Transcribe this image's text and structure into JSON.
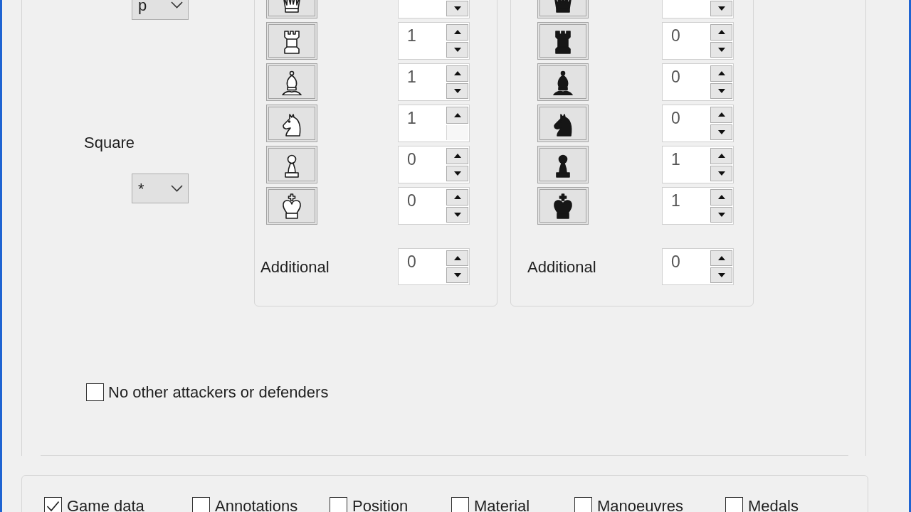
{
  "piece_filter": {
    "value": "p"
  },
  "square": {
    "label": "Square",
    "value": "*"
  },
  "groups": [
    {
      "kind": "white",
      "pieces": [
        {
          "kind": "queen",
          "down_button_shown": true
        },
        {
          "kind": "rook",
          "value": "1",
          "down_button_shown": true
        },
        {
          "kind": "bishop",
          "value": "1",
          "down_button_shown": true
        },
        {
          "kind": "knight",
          "value": "1",
          "down_button_shown": false
        },
        {
          "kind": "pawn",
          "value": "0",
          "down_button_shown": true
        },
        {
          "kind": "king",
          "value": "0",
          "down_button_shown": true
        }
      ],
      "additional": {
        "label": "Additional",
        "value": "0"
      }
    },
    {
      "kind": "black",
      "pieces": [
        {
          "kind": "queen",
          "down_button_shown": true
        },
        {
          "kind": "rook",
          "value": "0",
          "down_button_shown": true
        },
        {
          "kind": "bishop",
          "value": "0",
          "down_button_shown": true
        },
        {
          "kind": "knight",
          "value": "0",
          "down_button_shown": true
        },
        {
          "kind": "pawn",
          "value": "1",
          "down_button_shown": true
        },
        {
          "kind": "king",
          "value": "1",
          "down_button_shown": true
        }
      ],
      "additional": {
        "label": "Additional",
        "value": "0"
      }
    }
  ],
  "no_other": {
    "label": "No other attackers or defenders",
    "checked": false
  },
  "search_in": [
    {
      "label": "Game data",
      "checked": true
    },
    {
      "label": "Annotations",
      "checked": false
    },
    {
      "label": "Position",
      "checked": false
    },
    {
      "label": "Material",
      "checked": false
    },
    {
      "label": "Manoeuvres",
      "checked": false
    },
    {
      "label": "Medals",
      "checked": false
    }
  ]
}
